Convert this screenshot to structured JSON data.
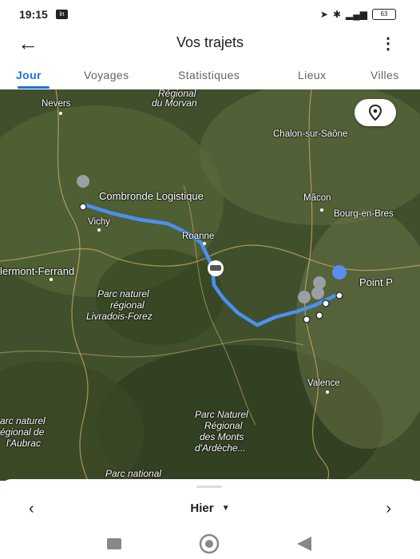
{
  "status": {
    "time": "19:15",
    "badge": "in",
    "battery": "63"
  },
  "appbar": {
    "title": "Vos trajets"
  },
  "tabs": [
    {
      "label": "Jour"
    },
    {
      "label": "Voyages"
    },
    {
      "label": "Statistiques"
    },
    {
      "label": "Lieux"
    },
    {
      "label": "Villes"
    }
  ],
  "map": {
    "labels": {
      "nevers": "Nevers",
      "morvan1": "Régional",
      "morvan2": "du Morvan",
      "chalon": "Chalon-sur-Saône",
      "combronde": "Combronde Logistique",
      "vichy": "Vichy",
      "macon": "Mâcon",
      "bourg": "Bourg-en-Bres",
      "roanne": "Roanne",
      "clermont": "lermont-Ferrand",
      "livradois1": "Parc naturel",
      "livradois2": "régional",
      "livradois3": "Livradois-Forez",
      "pointp": "Point P",
      "valence": "Valence",
      "aubrac1": "arc naturel",
      "aubrac2": "égional de",
      "aubrac3": "l'Aubrac",
      "ardeche1": "Parc Naturel",
      "ardeche2": "Régional",
      "ardeche3": "des Monts",
      "ardeche4": "d'Ardèche...",
      "bottom": "Parc national"
    },
    "route_color": "#4a90f5"
  },
  "sheet": {
    "date": "Hier",
    "prev": "‹",
    "next": "›"
  }
}
